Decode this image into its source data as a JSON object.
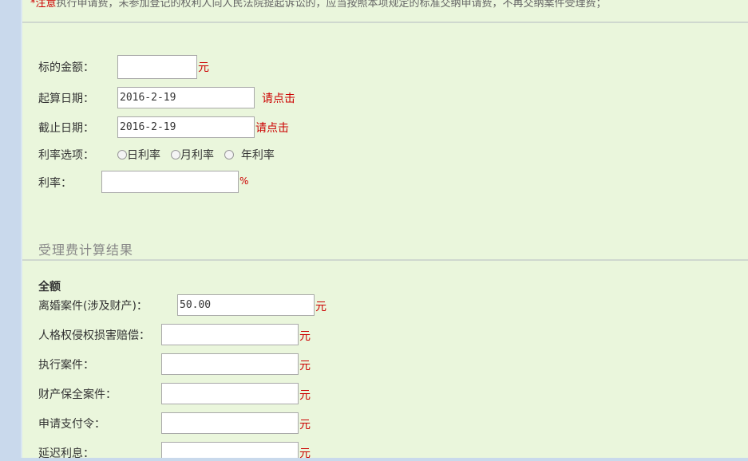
{
  "notice": {
    "prefix": "*注意",
    "text": "执行申请费，未参加登记的权利人向人民法院提起诉讼的，应当按照本项规定的标准交纳申请费，不再交纳案件受理费；"
  },
  "form": {
    "amount_label": "标的金额：",
    "amount_value": "",
    "amount_unit": "元",
    "start_label": "起算日期：",
    "start_value": "2016-2-19",
    "start_link": "请点击",
    "end_label": "截止日期：",
    "end_value": "2016-2-19",
    "end_link": "请点击",
    "rate_option_label": "利率选项：",
    "rate_options": [
      "日利率",
      "月利率",
      "年利率"
    ],
    "rate_label": "利率：",
    "rate_value": "",
    "rate_unit": "%"
  },
  "results": {
    "section_title": "受理费计算结果",
    "full_label": "全额",
    "rows": [
      {
        "label": "离婚案件(涉及财产)：",
        "value": "50.00",
        "unit": "元"
      },
      {
        "label": "人格权侵权损害赔偿：",
        "value": "",
        "unit": "元"
      },
      {
        "label": "执行案件：",
        "value": "",
        "unit": "元"
      },
      {
        "label": "财产保全案件：",
        "value": "",
        "unit": "元"
      },
      {
        "label": "申请支付令：",
        "value": "",
        "unit": "元"
      },
      {
        "label": "延迟利息：",
        "value": "",
        "unit": "元"
      }
    ]
  }
}
